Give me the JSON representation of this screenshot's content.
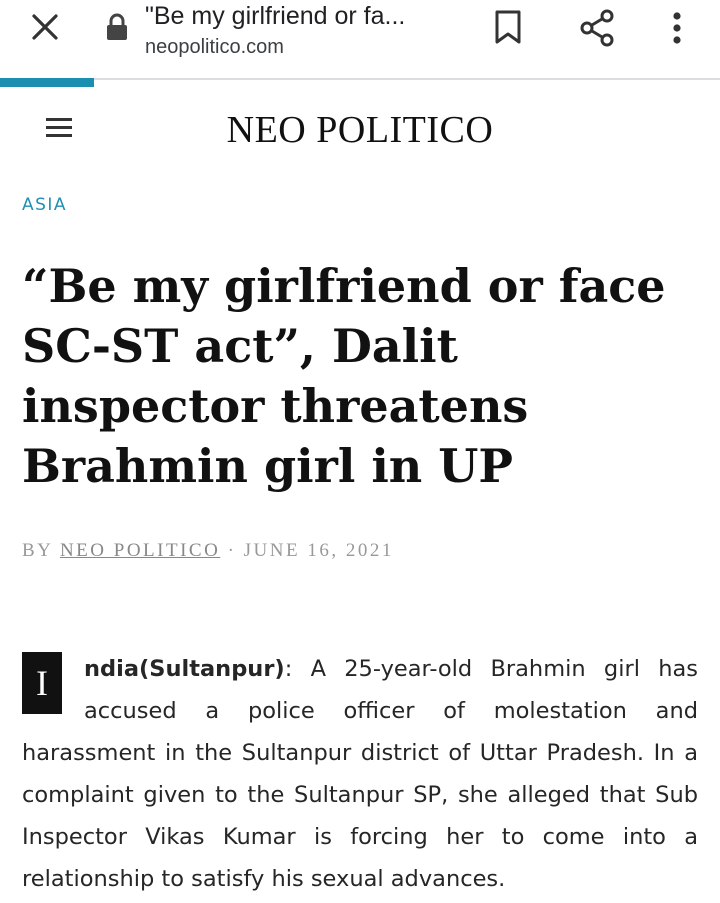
{
  "browser": {
    "tab_title": "\"Be my girlfriend or fa...",
    "url": "neopolitico.com",
    "load_progress": 0.13
  },
  "site": {
    "name": "NEO POLITICO"
  },
  "article": {
    "category": "ASIA",
    "headline": "“Be my girlfriend or face SC-ST act”, Dalit inspector threatens Brahmin girl in UP",
    "byline_prefix": "BY",
    "author": "NEO POLITICO",
    "date_separator": " · ",
    "date": "JUNE 16, 2021",
    "drop_cap": "I",
    "lead": "ndia(Sultanpur)",
    "body": ": A 25-year-old Brahmin girl has accused a police officer of molestation and harassment in the Sultanpur district of Uttar Pradesh. In a complaint given to the Sultanpur SP, she alleged that Sub Inspector Vikas Kumar is forcing her to come into a relationship to satisfy his sexual advances."
  },
  "colors": {
    "accent": "#1f8fb3",
    "progress": "#1a8fb0",
    "text": "#262626"
  },
  "icons": [
    "close-icon",
    "lock-icon",
    "bookmark-icon",
    "share-icon",
    "more-vert-icon",
    "hamburger-menu-icon"
  ]
}
